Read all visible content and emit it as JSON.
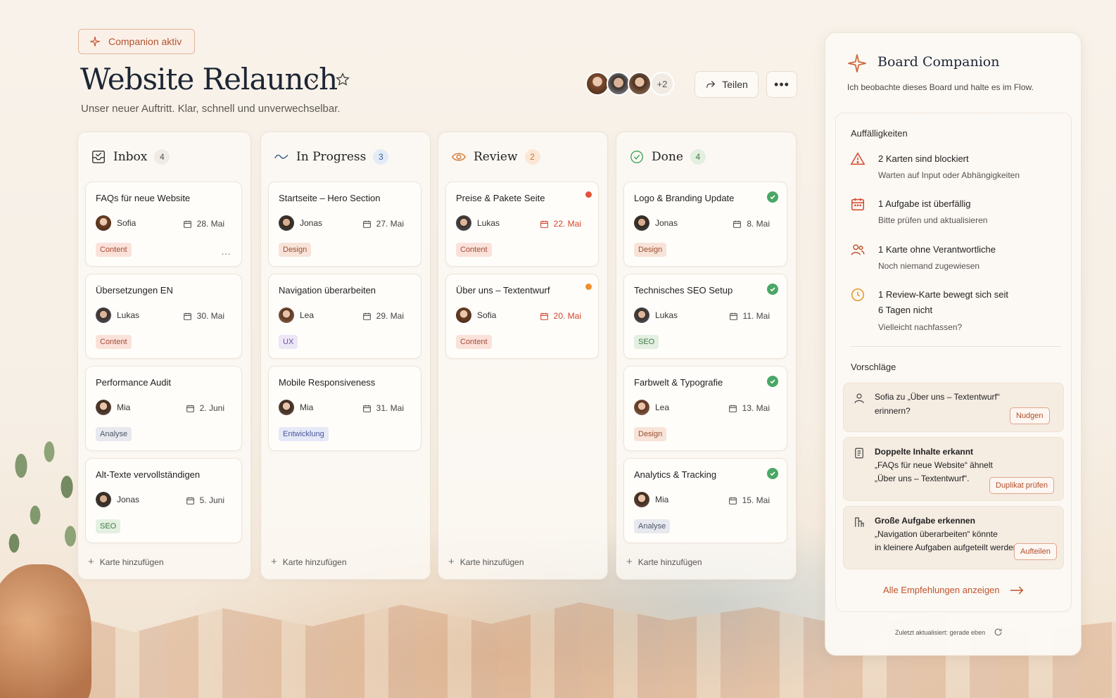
{
  "header": {
    "badge": "Companion aktiv",
    "title": "Website Relaunch",
    "subtitle": "Unser neuer Auftritt. Klar, schnell und unverwechselbar.",
    "members_more": "+2",
    "share_label": "Teilen",
    "more_label": "•••"
  },
  "colors": {
    "accent": "#c0542c",
    "late": "#d2452c",
    "done": "#4aa765"
  },
  "add_label": "Karte hinzufügen",
  "columns": [
    {
      "title": "Inbox",
      "count": "4",
      "icon": "inbox-icon",
      "cards": [
        {
          "title": "FAQs für neue Website",
          "person": "Sofia",
          "date": "28. Mai",
          "tag": "Content"
        },
        {
          "title": "Übersetzungen EN",
          "person": "Lukas",
          "date": "30. Mai",
          "tag": "Content"
        },
        {
          "title": "Performance Audit",
          "person": "Mia",
          "date": "2. Juni",
          "tag": "Analyse"
        },
        {
          "title": "Alt-Texte vervollständigen",
          "person": "Jonas",
          "date": "5. Juni",
          "tag": "SEO"
        }
      ]
    },
    {
      "title": "In Progress",
      "count": "3",
      "icon": "activity-wave-icon",
      "cards": [
        {
          "title": "Startseite – Hero Section",
          "person": "Jonas",
          "date": "27. Mai",
          "tag": "Design"
        },
        {
          "title": "Navigation überarbeiten",
          "person": "Lea",
          "date": "29. Mai",
          "tag": "UX"
        },
        {
          "title": "Mobile Responsiveness",
          "person": "Mia",
          "date": "31. Mai",
          "tag": "Entwicklung"
        }
      ]
    },
    {
      "title": "Review",
      "count": "2",
      "icon": "eye-icon",
      "cards": [
        {
          "title": "Preise & Pakete Seite",
          "person": "Lukas",
          "date": "22. Mai",
          "tag": "Content"
        },
        {
          "title": "Über uns – Textentwurf",
          "person": "Sofia",
          "date": "20. Mai",
          "tag": "Content"
        }
      ]
    },
    {
      "title": "Done",
      "count": "4",
      "icon": "check-circle-icon",
      "cards": [
        {
          "title": "Logo & Branding Update",
          "person": "Jonas",
          "date": "8. Mai",
          "tag": "Design"
        },
        {
          "title": "Technisches SEO Setup",
          "person": "Lukas",
          "date": "11. Mai",
          "tag": "SEO"
        },
        {
          "title": "Farbwelt & Typografie",
          "person": "Lea",
          "date": "13. Mai",
          "tag": "Design"
        },
        {
          "title": "Analytics & Tracking",
          "person": "Mia",
          "date": "15. Mai",
          "tag": "Analyse"
        }
      ]
    }
  ],
  "panel": {
    "title": "Board Companion",
    "subtitle": "Ich beobachte dieses Board und halte es im Flow.",
    "issues_heading": "Auffälligkeiten",
    "issues": [
      {
        "title": "2 Karten sind blockiert",
        "sub": "Warten auf Input oder Abhängigkeiten"
      },
      {
        "title": "1 Aufgabe ist überfällig",
        "sub": "Bitte prüfen und aktualisieren"
      },
      {
        "title": "1 Karte ohne Verantwortliche",
        "sub": "Noch niemand zugewiesen"
      },
      {
        "title": "1 Review-Karte bewegt sich seit 6 Tagen nicht",
        "sub": "Vielleicht nachfassen?"
      }
    ],
    "suggestions_heading": "Vorschläge",
    "suggestions": [
      {
        "line1": "Sofia zu „Über uns – Textentwurf“",
        "line2": "erinnern?",
        "line3": "",
        "button": "Nudgen"
      },
      {
        "line1": "Doppelte Inhalte erkannt",
        "line2": "„FAQs für neue Website“ ähnelt",
        "line3": "„Über uns – Textentwurf“.",
        "button": "Duplikat prüfen"
      },
      {
        "line1": "Große Aufgabe erkennen",
        "line2": "„Navigation überarbeiten“ könnte",
        "line3": "in kleinere Aufgaben aufgeteilt werden.",
        "button": "Aufteilen"
      }
    ],
    "all_link": "Alle Empfehlungen anzeigen",
    "footer": "Zuletzt aktualisiert: gerade eben"
  }
}
